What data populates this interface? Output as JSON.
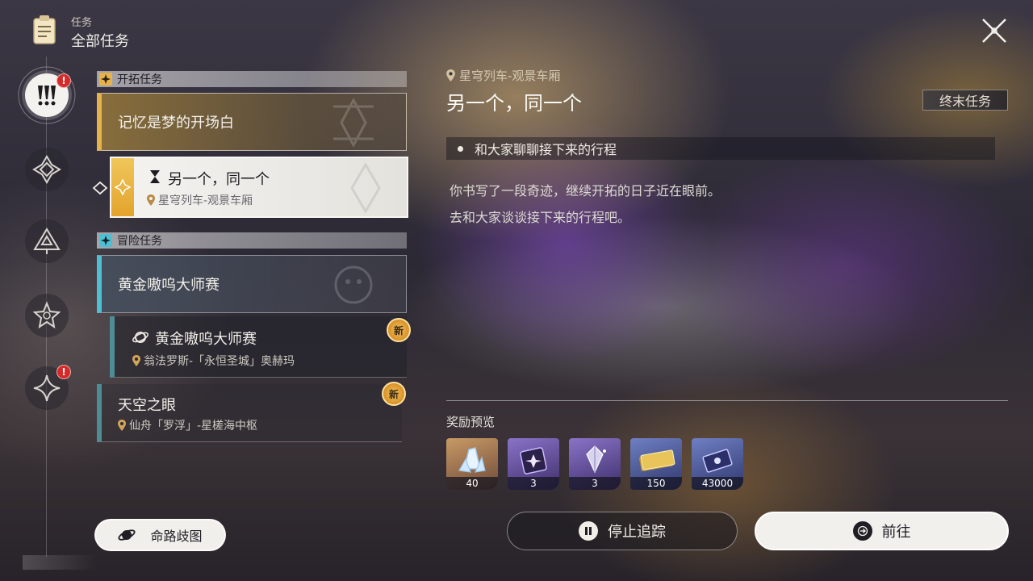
{
  "header": {
    "small_title": "任务",
    "big_title": "全部任务"
  },
  "rail": {
    "badge_1": "!",
    "badge_2": "!"
  },
  "sections": {
    "trailblaze": {
      "label": "开拓任务"
    },
    "adventure": {
      "label": "冒险任务"
    }
  },
  "quests": {
    "trail_main": {
      "title": "记忆是梦的开场白"
    },
    "trail_sub": {
      "title": "另一个，同一个",
      "location": "星穹列车-观景车厢"
    },
    "adv_main": {
      "title": "黄金嗷呜大师赛"
    },
    "adv_sub": {
      "title": "黄金嗷呜大师赛",
      "location": "翁法罗斯-「永恒圣城」奥赫玛",
      "badge": "新"
    },
    "adv_sky": {
      "title": "天空之眼",
      "location": "仙舟「罗浮」-星槎海中枢",
      "badge": "新"
    }
  },
  "branch_button": {
    "label": "命路歧图"
  },
  "detail": {
    "location": "星穹列车-观景车厢",
    "title": "另一个，同一个",
    "tag": "终末任务",
    "objective": "和大家聊聊接下来的行程",
    "desc_line1": "你书写了一段奇迹，继续开拓的日子近在眼前。",
    "desc_line2": "去和大家谈谈接下来的行程吧。"
  },
  "rewards": {
    "label": "奖励预览",
    "items": [
      {
        "icon": "stellar-jade-icon",
        "count": "40"
      },
      {
        "icon": "traveler-guide-icon",
        "count": "3"
      },
      {
        "icon": "refined-aether-icon",
        "count": "3"
      },
      {
        "icon": "credit-icon",
        "count": "150"
      },
      {
        "icon": "credit-ticket-icon",
        "count": "43000"
      }
    ]
  },
  "buttons": {
    "stop_tracking": "停止追踪",
    "go": "前往"
  },
  "colors": {
    "trailblaze_accent": "#e6b24a",
    "adventure_accent": "#4fbfd2",
    "badge_red": "#d42a2a",
    "new_badge": "#f4c260"
  }
}
